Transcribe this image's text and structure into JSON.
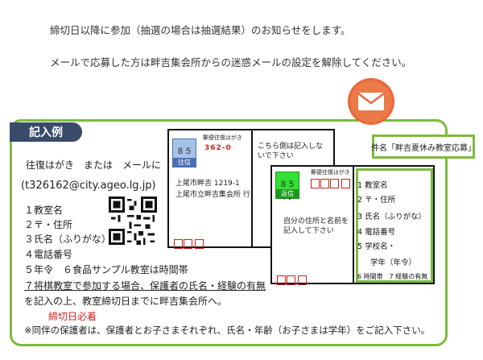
{
  "notices": [
    "締切日以降に参加（抽選の場合は抽選結果）のお知らせをします。",
    "メールで応募した方は畔吉集会所からの迷惑メールの設定を解除してください。"
  ],
  "example_label": "記入例",
  "left_block": {
    "line1": "往復はがき　または　メールに",
    "email": "(t326162@city.ageo.lg.jp)",
    "items": [
      "１教室名",
      "２〒・住所",
      "３氏名（ふりがな）",
      "４電話番号",
      "５年令　６食品サンプル教室は時間帯",
      "７将棋教室で参加する場合、保護者の氏名・経験の有無",
      "を記入の上、教室締切日までに畔吉集会所へ。"
    ],
    "deadline_required": "締切日必着",
    "footnote": "※同伴の保護者は、保護者とお子さまそれぞれ、氏名・年齢（お子さまは学年）をご記入下さい。"
  },
  "postcard_outgoing": {
    "postage_label": "郵便往復はがき",
    "stamp_value": "８５円",
    "stamp_type": "往信",
    "zip": "362-0",
    "address_line1": "上尾市畔吉 1219-1",
    "address_line2": "上尾市立畔吉集会所 行"
  },
  "postcard_middle_note": "こちら側は記入しないで下さい",
  "postcard_reply": {
    "postage_label": "郵便往復はがき",
    "stamp_value": "８５円",
    "stamp_type": "返信",
    "instruction": "自分の住所と名前を記入して下さい"
  },
  "subject_callout": "件名「畔吉夏休み教室応募」",
  "reply_list": [
    "1 教室名",
    "2 〒・住所",
    "3 氏名（ふりがな）",
    "4 電話番号",
    "5 学校名・",
    "学年（年令）",
    "6 時間帯　7 経験の有無"
  ],
  "colors": {
    "frame_green": "#7dbb3d",
    "label_navy": "#3a4a6b",
    "mail_orange": "#e8683a",
    "required_red": "#d02020"
  },
  "icons": [
    "mail-envelope-icon",
    "qr-code-icon"
  ]
}
